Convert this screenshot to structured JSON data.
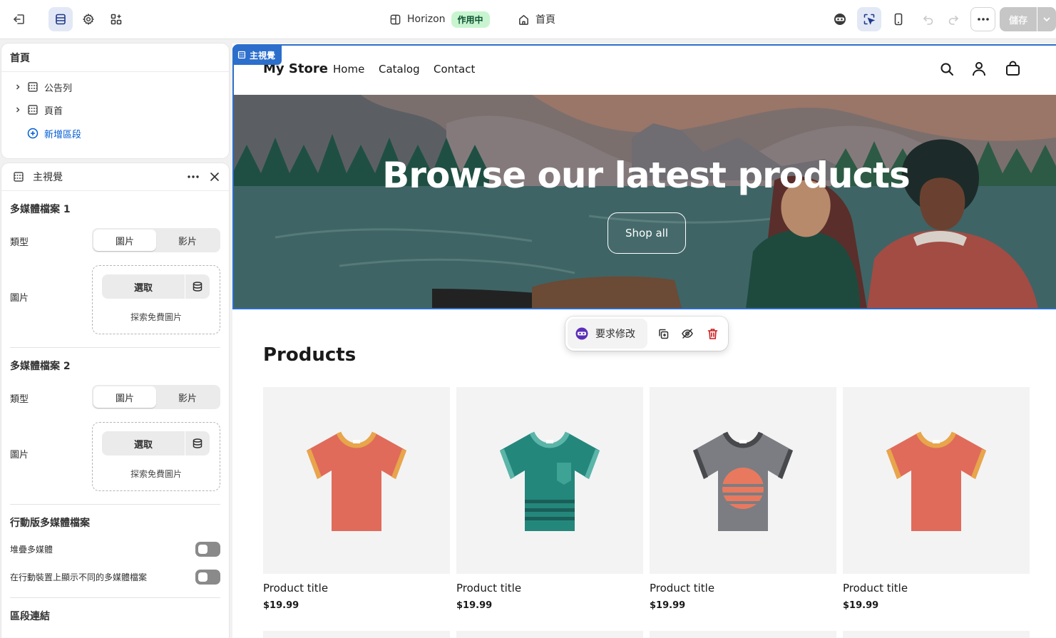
{
  "toolbar": {
    "exit_icon": "exit-icon",
    "sections_icon": "sections-icon",
    "settings_icon": "gear-icon",
    "apps_icon": "apps-icon",
    "theme_name": "Horizon",
    "theme_status": "作用中",
    "page_name": "首頁",
    "save_label": "儲存"
  },
  "section_tree": {
    "title": "首頁",
    "items": [
      {
        "label": "公告列"
      },
      {
        "label": "頁首"
      }
    ],
    "add_label": "新增區段"
  },
  "settings_panel": {
    "title": "主視覺",
    "media1": {
      "title": "多媒體檔案 1",
      "type_label": "類型",
      "type_options": [
        "圖片",
        "影片"
      ],
      "selected_type": "圖片",
      "image_label": "圖片",
      "select_label": "選取",
      "explore_label": "探索免費圖片"
    },
    "media2": {
      "title": "多媒體檔案 2",
      "type_label": "類型",
      "type_options": [
        "圖片",
        "影片"
      ],
      "selected_type": "圖片",
      "image_label": "圖片",
      "select_label": "選取",
      "explore_label": "探索免費圖片"
    },
    "mobile": {
      "title": "行動版多媒體檔案",
      "stack_label": "堆疊多媒體",
      "stack_on": false,
      "different_label": "在行動裝置上顯示不同的多媒體檔案",
      "different_on": false
    },
    "section_link_title": "區段連結"
  },
  "preview": {
    "selected_tag": "主視覺",
    "store_name": "My Store",
    "nav": [
      "Home",
      "Catalog",
      "Contact"
    ],
    "hero_title": "Browse our latest products",
    "hero_button": "Shop all",
    "floating_bar": {
      "ask_label": "要求修改"
    },
    "products_heading": "Products",
    "products": [
      {
        "title": "Product title",
        "price": "$19.99",
        "shirt": "coral"
      },
      {
        "title": "Product title",
        "price": "$19.99",
        "shirt": "teal-striped"
      },
      {
        "title": "Product title",
        "price": "$19.99",
        "shirt": "gray-sunset"
      },
      {
        "title": "Product title",
        "price": "$19.99",
        "shirt": "coral"
      }
    ]
  },
  "colors": {
    "accent": "#2c6ecb",
    "active_badge_bg": "#c8f5cf",
    "active_badge_text": "#0c5132",
    "delete": "#c91c1c"
  }
}
